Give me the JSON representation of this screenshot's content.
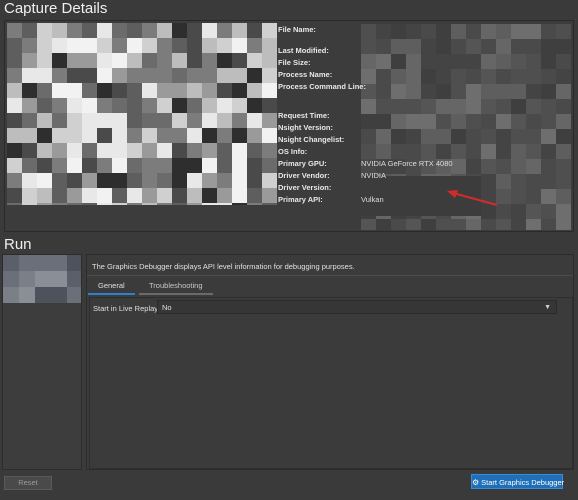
{
  "capture": {
    "title": "Capture Details",
    "fields": [
      {
        "label": "File Name:",
        "value": ""
      },
      {
        "label": "Last Modified:",
        "value": ""
      },
      {
        "label": "File Size:",
        "value": ""
      },
      {
        "label": "Process Name:",
        "value": ""
      },
      {
        "label": "Process Command Line:",
        "value": ""
      },
      {
        "label": "Request Time:",
        "value": ""
      },
      {
        "label": "Nsight Version:",
        "value": ""
      },
      {
        "label": "Nsight Changelist:",
        "value": ""
      },
      {
        "label": "OS Info:",
        "value": ""
      },
      {
        "label": "Primary GPU:",
        "value": "NVIDIA GeForce RTX 4080"
      },
      {
        "label": "Driver Vendor:",
        "value": "NVIDIA"
      },
      {
        "label": "Driver Version:",
        "value": ""
      },
      {
        "label": "Primary API:",
        "value": "Vulkan"
      }
    ]
  },
  "run": {
    "title": "Run",
    "description": "The Graphics Debugger displays API level information for debugging purposes.",
    "tabs": [
      {
        "label": "General",
        "active": true
      },
      {
        "label": "Troubleshooting",
        "active": false
      }
    ],
    "option_label": "Start in Live Replay:",
    "option_value": "No"
  },
  "buttons": {
    "reset": "Reset",
    "start": "Start Graphics Debugger"
  },
  "colors": {
    "accent": "#2f7fcf",
    "arrow": "#d42a2a",
    "start_button": "#1e6fb8"
  }
}
